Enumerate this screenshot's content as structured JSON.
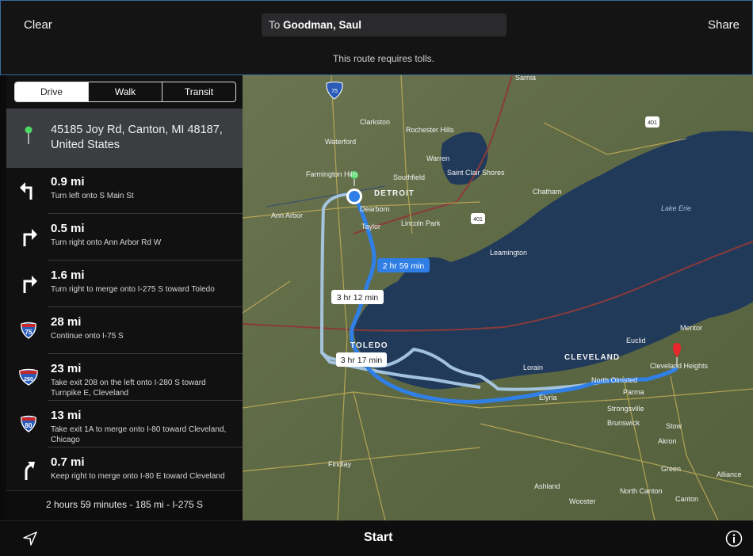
{
  "header": {
    "clear_label": "Clear",
    "share_label": "Share",
    "destination_prefix": "To ",
    "destination_name": "Goodman, Saul",
    "toll_notice": "This route requires tolls."
  },
  "transport_modes": [
    {
      "label": "Drive",
      "selected": true
    },
    {
      "label": "Walk",
      "selected": false
    },
    {
      "label": "Transit",
      "selected": false
    }
  ],
  "origin": {
    "address_line1": "45185 Joy Rd, Canton, MI  48187,",
    "address_line2": "United States"
  },
  "steps": [
    {
      "icon": "turn-left-icon",
      "distance": "0.9 mi",
      "instruction": "Turn left onto S Main St"
    },
    {
      "icon": "turn-right-icon",
      "distance": "0.5 mi",
      "instruction": "Turn right onto Ann Arbor Rd W"
    },
    {
      "icon": "turn-right-icon",
      "distance": "1.6 mi",
      "instruction": "Turn right to merge onto I-275 S toward Toledo"
    },
    {
      "icon": "interstate-75-shield-icon",
      "shield": "75",
      "distance": "28 mi",
      "instruction": "Continue onto I-75 S"
    },
    {
      "icon": "interstate-280-shield-icon",
      "shield": "280",
      "distance": "23 mi",
      "instruction": "Take exit 208 on the left onto I-280 S toward Turnpike E, Cleveland"
    },
    {
      "icon": "interstate-80-shield-icon",
      "shield": "80",
      "distance": "13 mi",
      "instruction": "Take exit 1A to merge onto I-80 toward Cleveland, Chicago"
    },
    {
      "icon": "keep-right-icon",
      "distance": "0.7 mi",
      "instruction": "Keep right to merge onto I-80 E toward Cleveland"
    }
  ],
  "summary": "2 hours 59 minutes - 185 mi - I-275 S",
  "map": {
    "route_labels": {
      "primary": "2 hr 59 min",
      "alt1": "3 hr 12 min",
      "alt2": "3 hr 17 min"
    },
    "place_labels": {
      "sarnia": "Sarnia",
      "clarkston": "Clarkston",
      "rochester_hills": "Rochester Hills",
      "waterford": "Waterford",
      "warren": "Warren",
      "farmington_hills": "Farmington Hills",
      "southfield": "Southfield",
      "saint_clair_shores": "Saint Clair Shores",
      "detroit": "DETROIT",
      "chatham": "Chatham",
      "ann_arbor": "Ann Arbor",
      "dearborn": "Dearborn",
      "lincoln_park": "Lincoln Park",
      "taylor": "Taylor",
      "lake_erie": "Lake Erie",
      "leamington": "Leamington",
      "toledo": "TOLEDO",
      "cleveland": "CLEVELAND",
      "euclid": "Euclid",
      "mentor": "Mentor",
      "lorain": "Lorain",
      "cleveland_heights": "Cleveland Heights",
      "north_olmsted": "North Olmsted",
      "parma": "Parma",
      "elyria": "Elyria",
      "strongsville": "Strongsville",
      "brunswick": "Brunswick",
      "stow": "Stow",
      "akron": "Akron",
      "green": "Green",
      "alliance": "Alliance",
      "findlay": "Findlay",
      "ashland": "Ashland",
      "north_canton": "North Canton",
      "wooster": "Wooster",
      "canton": "Canton"
    },
    "shields": {
      "i75": "75",
      "s401a": "401",
      "s401b": "401"
    },
    "colors": {
      "primary_route": "#2f7fe6",
      "alt_route": "#a9c8e6",
      "lake": "#213a5a",
      "land": "#5f6b46"
    }
  },
  "footer": {
    "start_label": "Start"
  },
  "colors": {
    "accent": "#2f7fe6",
    "origin_pin": "#4cd964",
    "destination_pin": "#e8282c"
  }
}
